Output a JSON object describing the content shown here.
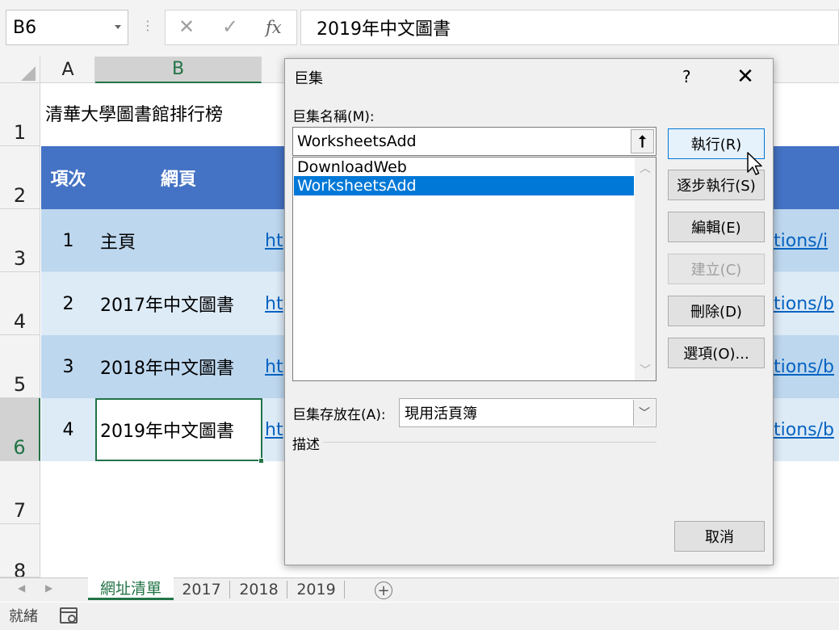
{
  "formula_bar": {
    "name_box": "B6",
    "cancel_icon": "✕",
    "enter_icon": "✓",
    "fx_label": "fx",
    "content": "2019年中文圖書"
  },
  "columns": [
    "A",
    "B"
  ],
  "rows": [
    {
      "num": "1",
      "a": "",
      "b": "清華大學圖書館排行榜",
      "link": ""
    },
    {
      "num": "2",
      "a": "項次",
      "b": "網頁",
      "link": ""
    },
    {
      "num": "3",
      "a": "1",
      "b": "主頁",
      "link_left": "ht",
      "link_right": "tions/i"
    },
    {
      "num": "4",
      "a": "2",
      "b": "2017年中文圖書",
      "link_left": "ht",
      "link_right": "tions/b"
    },
    {
      "num": "5",
      "a": "3",
      "b": "2018年中文圖書",
      "link_left": "ht",
      "link_right": "tions/b"
    },
    {
      "num": "6",
      "a": "4",
      "b": "2019年中文圖書",
      "link_left": "ht",
      "link_right": "tions/b"
    },
    {
      "num": "7"
    },
    {
      "num": "8"
    }
  ],
  "colors": {
    "header_band": "#4472c4",
    "row_dark": "#bdd7ee",
    "row_light": "#ddebf7",
    "selection": "#217346",
    "link": "#0563c1",
    "list_selected": "#0078d7"
  },
  "sheet_tabs": [
    "網址清單",
    "2017",
    "2018",
    "2019"
  ],
  "status": {
    "ready": "就緒"
  },
  "dialog": {
    "title": "巨集",
    "help": "?",
    "close": "✕",
    "name_label": "巨集名稱(M):",
    "name_value": "WorksheetsAdd",
    "macros": [
      "DownloadWeb",
      "WorksheetsAdd"
    ],
    "selected_index": 1,
    "buttons": {
      "run": "執行(R)",
      "step_into": "逐步執行(S)",
      "edit": "編輯(E)",
      "create": "建立(C)",
      "delete": "刪除(D)",
      "options": "選項(O)...",
      "cancel": "取消"
    },
    "macros_in_label": "巨集存放在(A):",
    "macros_in_value": "現用活頁簿",
    "description_label": "描述"
  }
}
